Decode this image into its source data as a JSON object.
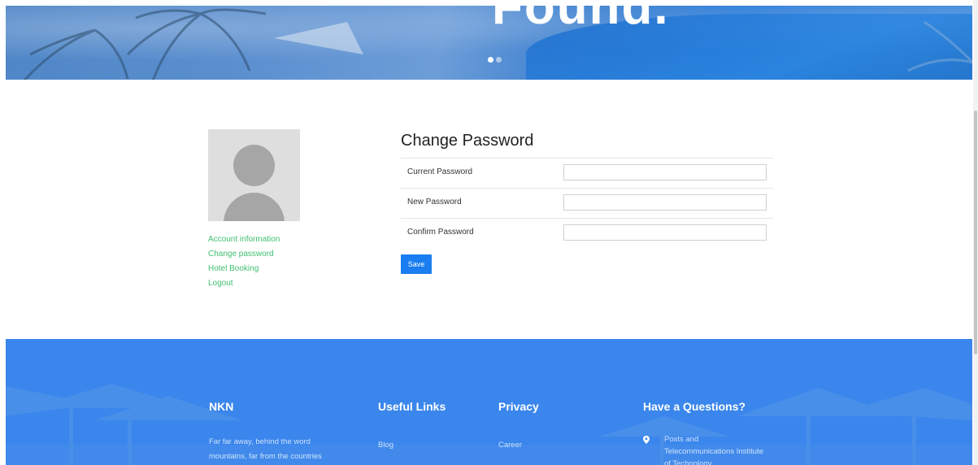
{
  "hero": {
    "heading": "Found.",
    "slides": [
      true,
      false
    ]
  },
  "sidebar": {
    "avatar_icon": "user-placeholder-icon",
    "menu": [
      {
        "label": "Account information"
      },
      {
        "label": "Change password"
      },
      {
        "label": "Hotel Booking"
      },
      {
        "label": "Logout"
      }
    ],
    "link_color": "#3fbf6f"
  },
  "form": {
    "title": "Change Password",
    "fields": [
      {
        "label": "Current Password",
        "value": ""
      },
      {
        "label": "New Password",
        "value": ""
      },
      {
        "label": "Confirm Password",
        "value": ""
      }
    ],
    "save_label": "Save",
    "button_color": "#1a7ef0"
  },
  "footer": {
    "background": "#3a86ec",
    "brand": {
      "title": "NKN",
      "text_line1": "Far far away, behind the word",
      "text_line2": "mountains, far from the countries"
    },
    "useful_links": {
      "title": "Useful Links",
      "items": [
        "Blog"
      ]
    },
    "privacy": {
      "title": "Privacy",
      "items": [
        "Career"
      ]
    },
    "contact": {
      "title": "Have a Questions?",
      "icon": "map-pin-icon",
      "address_line1": "Posts and",
      "address_line2": "Telecommunications Institute",
      "address_line3": "of Technology"
    }
  }
}
